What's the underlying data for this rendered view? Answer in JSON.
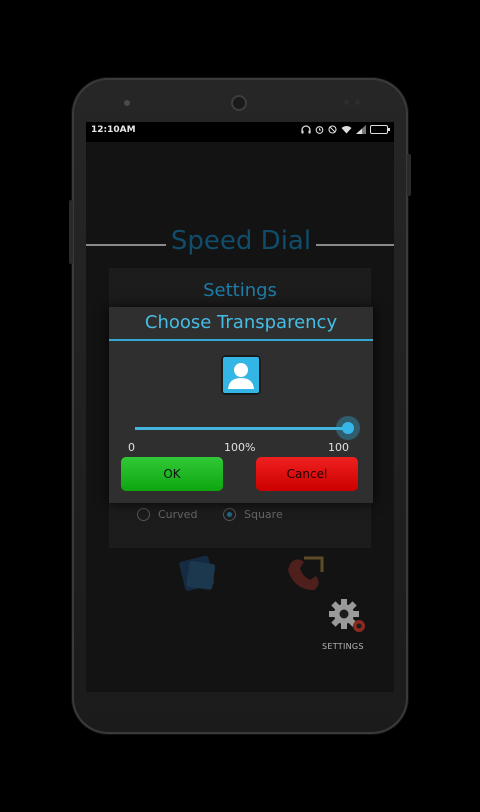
{
  "status_bar": {
    "time": "12:10AM",
    "icons": [
      "headphones-icon",
      "alarm-icon",
      "do-not-disturb-icon",
      "wifi-icon",
      "signal-icon",
      "battery-icon"
    ]
  },
  "app": {
    "title": "Speed Dial",
    "settings_title": "Settings",
    "shape_options": [
      {
        "label": "Curved",
        "selected": false
      },
      {
        "label": "Square",
        "selected": true
      }
    ],
    "settings_shortcut_label": "SETTINGS"
  },
  "dialog": {
    "title": "Choose Transparency",
    "slider": {
      "min_label": "0",
      "mid_label": "100%",
      "max_label": "100",
      "value": 100
    },
    "ok_label": "OK",
    "cancel_label": "Cancel"
  },
  "colors": {
    "accent": "#33b5e5",
    "ok": "#1db81f",
    "cancel": "#e00000",
    "title_dim": "#0f4d6b"
  }
}
